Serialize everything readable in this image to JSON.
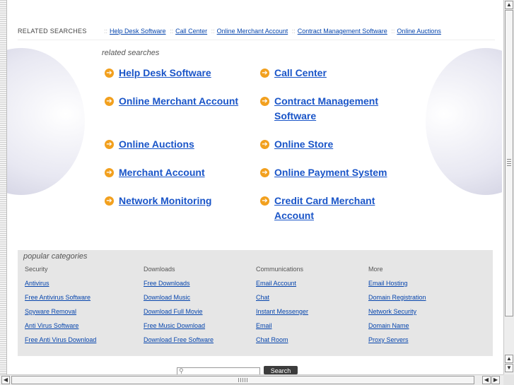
{
  "related_bar": {
    "title": "RELATED SEARCHES",
    "sep": "::",
    "links": [
      "Help Desk Software",
      "Call Center",
      "Online Merchant Account",
      "Contract Management Software",
      "Online Auctions"
    ]
  },
  "related": {
    "caption": "related searches",
    "links": [
      {
        "label": "Help Desk Software"
      },
      {
        "label": "Call Center"
      },
      {
        "label": "Online Merchant Account"
      },
      {
        "label": "Contract Management Software"
      },
      {
        "label": "Online Auctions"
      },
      {
        "label": "Online Store"
      },
      {
        "label": "Merchant Account"
      },
      {
        "label": "Online Payment System"
      },
      {
        "label": "Network Monitoring"
      },
      {
        "label": "Credit Card Merchant Account"
      }
    ]
  },
  "popular": {
    "caption": "popular categories",
    "columns": [
      {
        "heading": "Security",
        "links": [
          "Antivirus",
          "Free Antivirus Software",
          "Spyware Removal",
          "Anti Virus Software",
          "Free Anti Virus Download"
        ]
      },
      {
        "heading": "Downloads",
        "links": [
          "Free Downloads",
          "Download Music",
          "Download Full Movie",
          "Free Music Download",
          "Download Free Software"
        ]
      },
      {
        "heading": "Communications",
        "links": [
          "Email Account",
          "Chat",
          "Instant Messenger",
          "Email",
          "Chat Room"
        ]
      },
      {
        "heading": "More",
        "links": [
          "Email Hosting",
          "Domain Registration",
          "Network Security",
          "Domain Name",
          "Proxy Servers"
        ]
      }
    ]
  },
  "search": {
    "button_label": "Search",
    "value": ""
  },
  "scrollbars": {
    "up": "▲",
    "down": "▼",
    "left": "◀",
    "right": "▶"
  }
}
